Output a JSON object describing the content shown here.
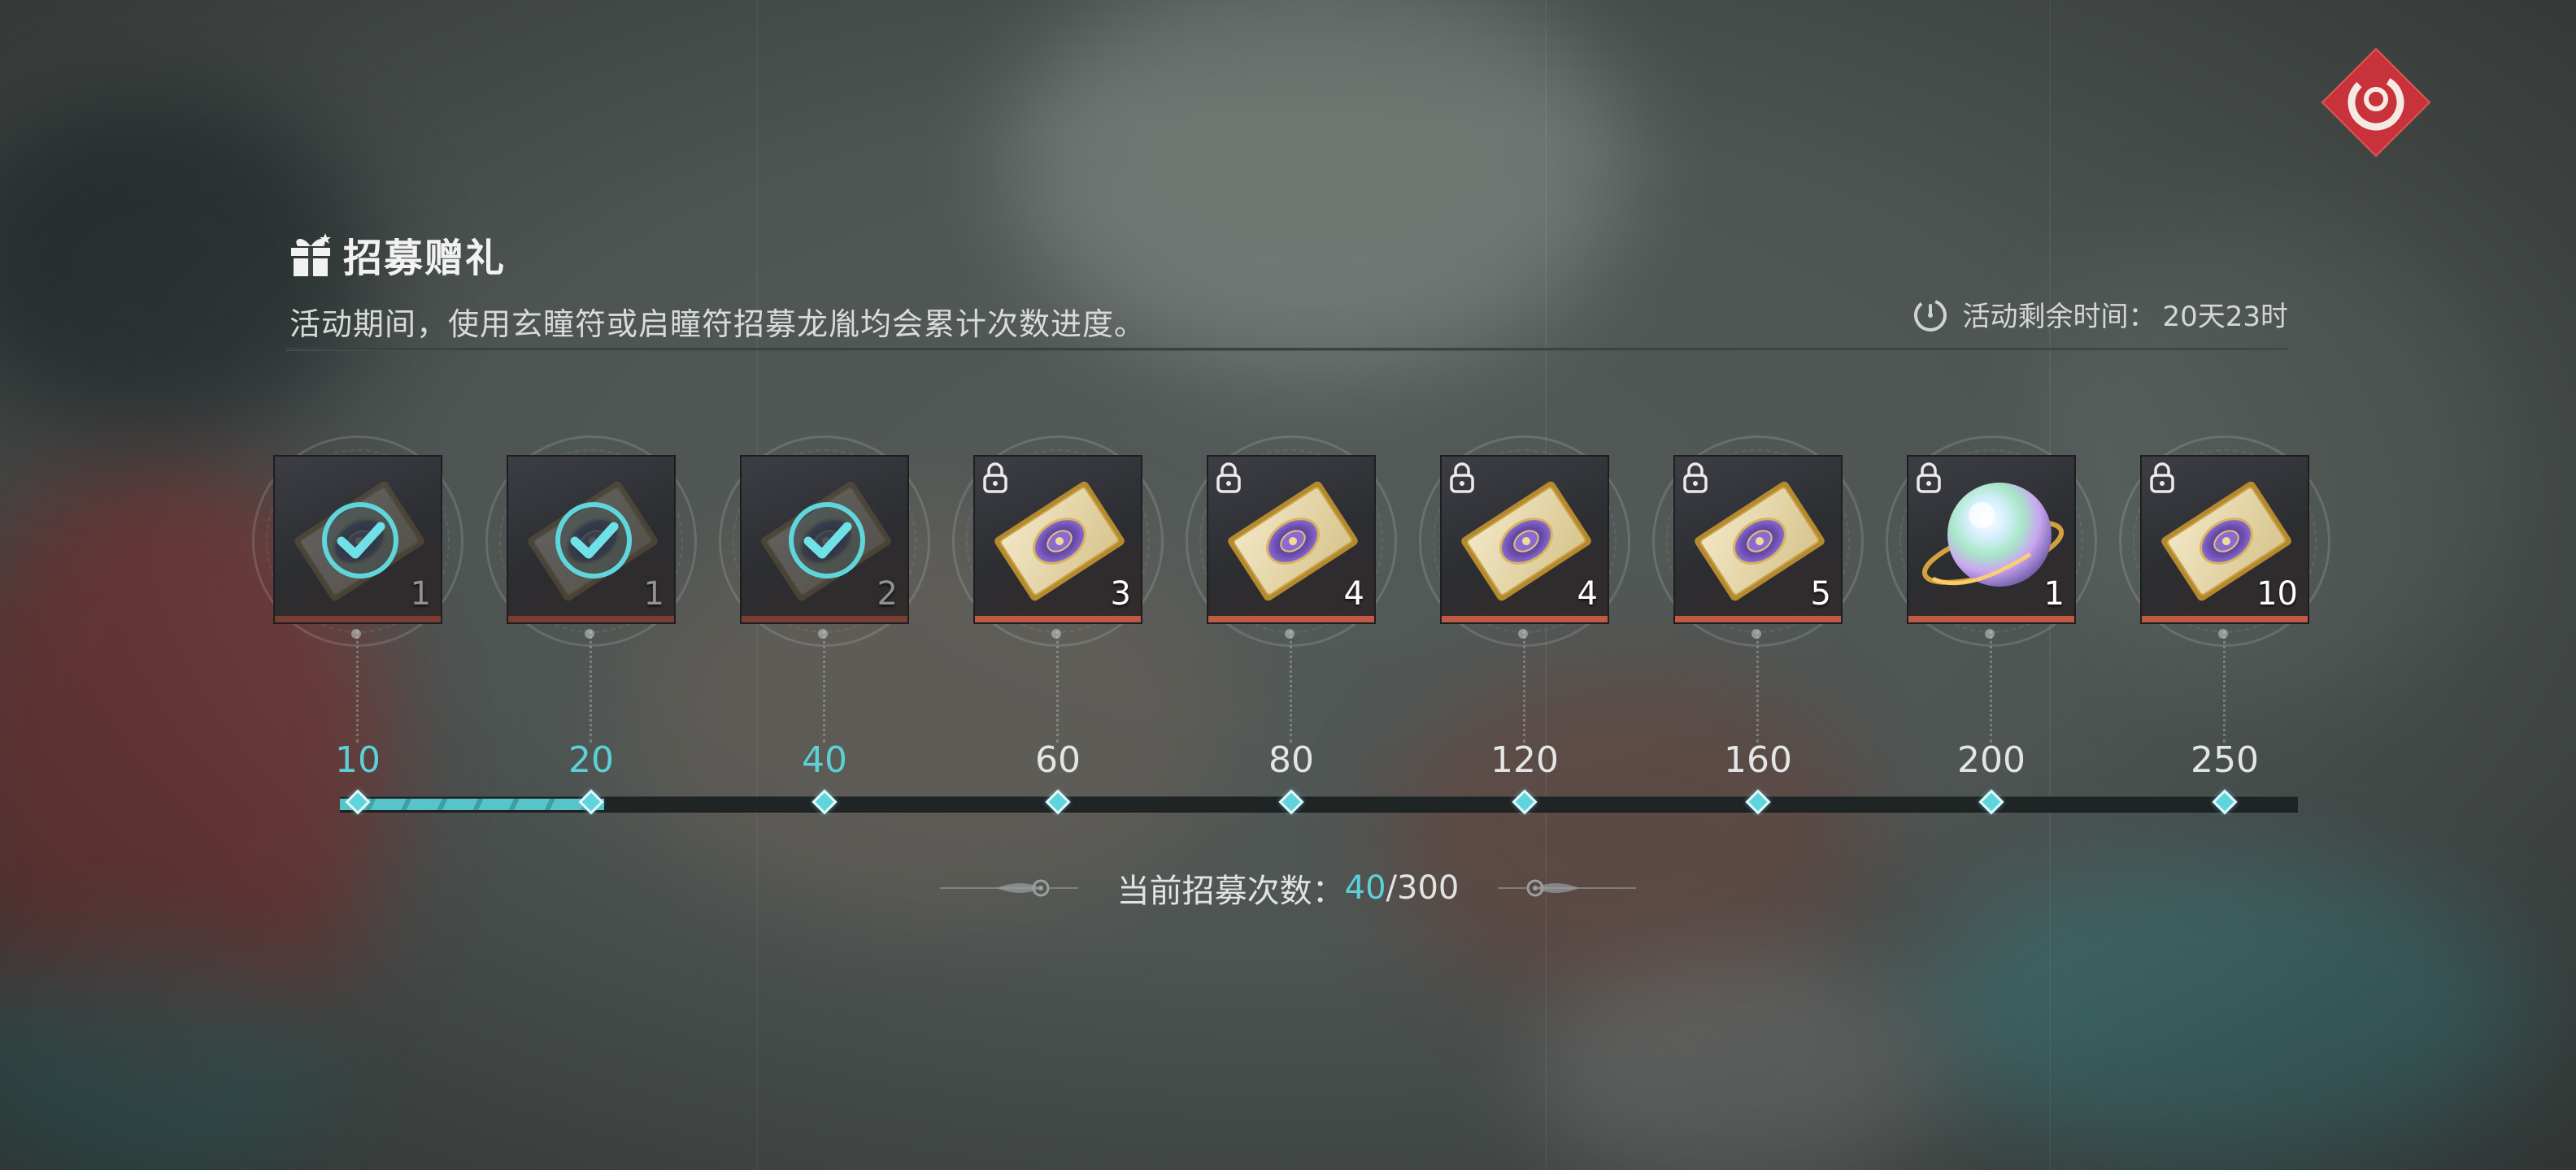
{
  "header": {
    "title": "招募赠礼",
    "description": "活动期间，使用玄瞳符或启瞳符招募龙胤均会累计次数进度。",
    "timer_label": "活动剩余时间：",
    "timer_value": "20天23时"
  },
  "rewards": [
    {
      "milestone": "10",
      "qty": "1",
      "item": "xuantong-talisman",
      "status": "claimed"
    },
    {
      "milestone": "20",
      "qty": "1",
      "item": "xuantong-talisman",
      "status": "claimed"
    },
    {
      "milestone": "40",
      "qty": "2",
      "item": "xuantong-talisman",
      "status": "claimed"
    },
    {
      "milestone": "60",
      "qty": "3",
      "item": "xuantong-talisman",
      "status": "locked"
    },
    {
      "milestone": "80",
      "qty": "4",
      "item": "xuantong-talisman",
      "status": "locked"
    },
    {
      "milestone": "120",
      "qty": "4",
      "item": "xuantong-talisman",
      "status": "locked"
    },
    {
      "milestone": "160",
      "qty": "5",
      "item": "xuantong-talisman",
      "status": "locked"
    },
    {
      "milestone": "200",
      "qty": "1",
      "item": "rainbow-orb",
      "status": "locked"
    },
    {
      "milestone": "250",
      "qty": "10",
      "item": "xuantong-talisman",
      "status": "locked"
    }
  ],
  "progress": {
    "label": "当前招募次数：",
    "current": "40",
    "separator": "/",
    "total": "300",
    "fill_fraction": 0.135
  },
  "colors": {
    "accent_cyan": "#5bd0d6",
    "close_red": "#c8323a",
    "card_bottom_red": "#c05a45"
  },
  "icons": {
    "close": "close-icon",
    "gift": "gift-icon",
    "timer": "timer-icon",
    "check": "check-icon",
    "lock": "lock-icon"
  }
}
